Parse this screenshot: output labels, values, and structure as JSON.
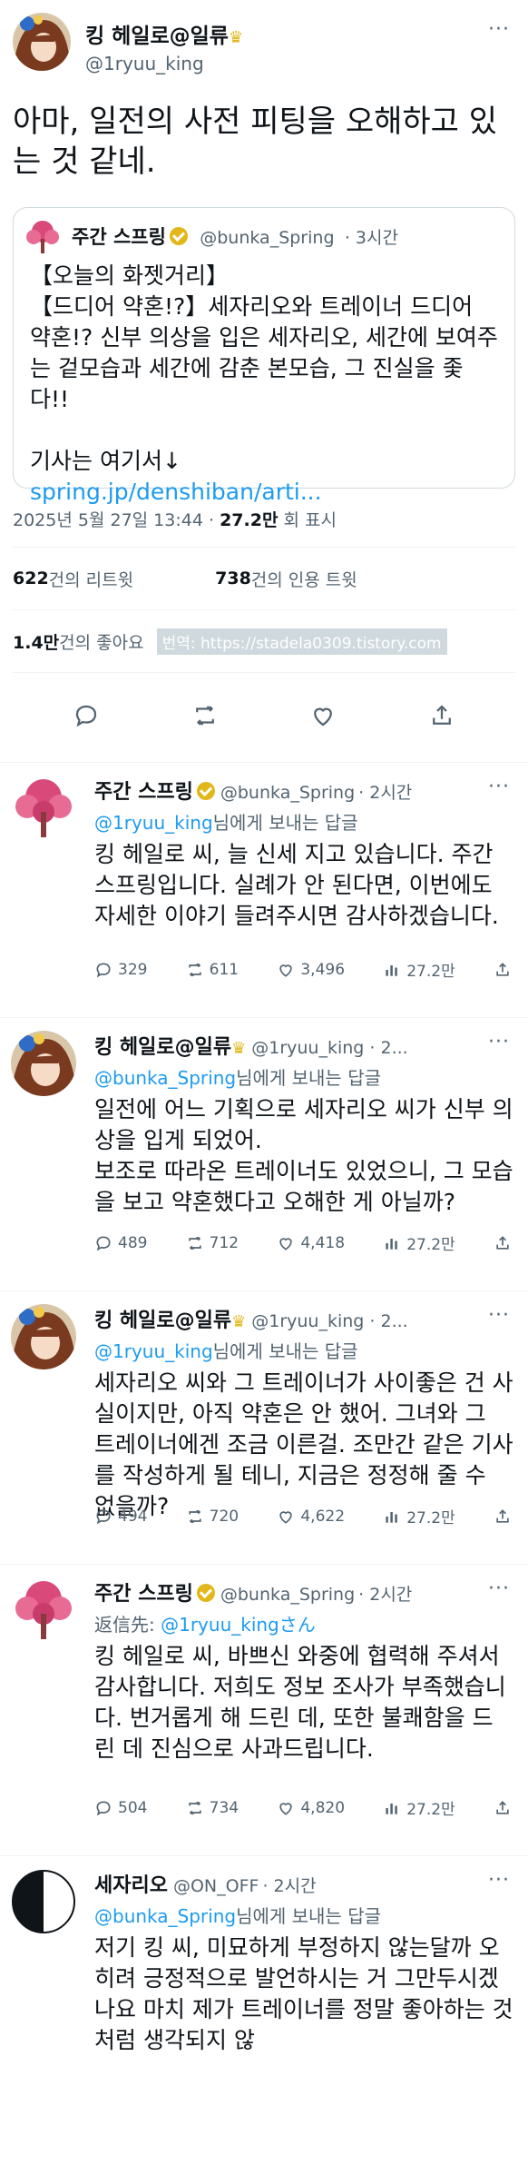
{
  "tweet": {
    "author_name": "킹 헤일로@일류",
    "author_handle": "@1ryuu_king",
    "text": "아마, 일전의 사전 피팅을 오해하고 있는 것 같네.",
    "more_label": "···",
    "quote": {
      "name": "주간 스프링",
      "handle": "@bunka_Spring",
      "time": "· 3시간",
      "text": "【오늘의 화젯거리】\n【드디어 약혼!?】세자리오와 트레이너 드디어 약혼!? 신부 의상을 입은 세자리오, 세간에 보여주는 겉모습과 세간에 감춘 본모습, 그 진실을 좇다!!\n\n기사는 여기서↓",
      "link": "spring.jp/denshiban/arti..."
    },
    "datetime": "2025년 5월 27일  13:44 · ",
    "views_count": "27.2만",
    "views_label": " 회 표시",
    "retweets_count": "622",
    "retweets_label": " 건의 리트윗",
    "quotes_count": "738",
    "quotes_label": " 건의 인용 트윗",
    "likes_count": "1.4만",
    "likes_label": " 건의 좋아요",
    "translate_label": "번역: https://stadela0309.tistory.com"
  },
  "replies": [
    {
      "name": "주간 스프링",
      "handle": "@bunka_Spring",
      "time": "· 2시간",
      "to_handle": "@1ryuu_king",
      "to_suffix": "님에게 보내는 답글",
      "text": "킹 헤일로 씨, 늘 신세 지고 있습니다. 주간 스프링입니다. 실례가 안 된다면, 이번에도 자세한 이야기 들려주시면 감사하겠습니다.",
      "replies": "329",
      "retweets": "611",
      "likes": "3,496",
      "views": "27.2만"
    },
    {
      "name": "킹 헤일로@일류",
      "handle": "@1ryuu_king · 2...",
      "time": "",
      "to_handle": "@bunka_Spring",
      "to_suffix": "님에게 보내는 답글",
      "text": "일전에 어느 기획으로 세자리오 씨가 신부 의상을 입게 되었어.\n보조로 따라온 트레이너도 있었으니, 그 모습을 보고 약혼했다고 오해한 게 아닐까?",
      "replies": "489",
      "retweets": "712",
      "likes": "4,418",
      "views": "27.2만"
    },
    {
      "name": "킹 헤일로@일류",
      "handle": "@1ryuu_king · 2...",
      "time": "",
      "to_handle": "@1ryuu_king",
      "to_suffix": "님에게 보내는 답글",
      "text": "세자리오 씨와 그 트레이너가 사이좋은 건 사실이지만, 아직 약혼은 안 했어. 그녀와 그 트레이너에겐 조금 이른걸. 조만간 같은 기사를 작성하게 될 테니, 지금은 정정해 줄 수 없을까?",
      "replies": "494",
      "retweets": "720",
      "likes": "4,622",
      "views": "27.2만"
    },
    {
      "name": "주간 스프링",
      "handle": "@bunka_Spring",
      "time": "· 2시간",
      "to_handle": "@1ryuu_kingさん",
      "to_suffix": "",
      "to_prefix": "返信先: ",
      "text": "킹 헤일로 씨, 바쁘신 와중에 협력해 주셔서 감사합니다. 저희도 정보 조사가 부족했습니다. 번거롭게 해 드린 데, 또한 불쾌함을 드린 데 진심으로 사과드립니다.",
      "replies": "504",
      "retweets": "734",
      "likes": "4,820",
      "views": "27.2만"
    },
    {
      "name": "세자리오",
      "handle": "@ON_OFF",
      "time": "· 2시간",
      "to_handle": "@bunka_Spring",
      "to_suffix": "님에게 보내는 답글",
      "text": "저기 킹 씨, 미묘하게 부정하지 않는달까 오히려 긍정적으로 발언하시는 거 그만두시겠나요 마치 제가 트레이너를 정말 좋아하는 것처럼 생각되지 않"
    }
  ],
  "colors": {
    "accent": "#1d9bf0",
    "gold": "#e2b719",
    "text": "#0f1419",
    "muted": "#536471"
  }
}
